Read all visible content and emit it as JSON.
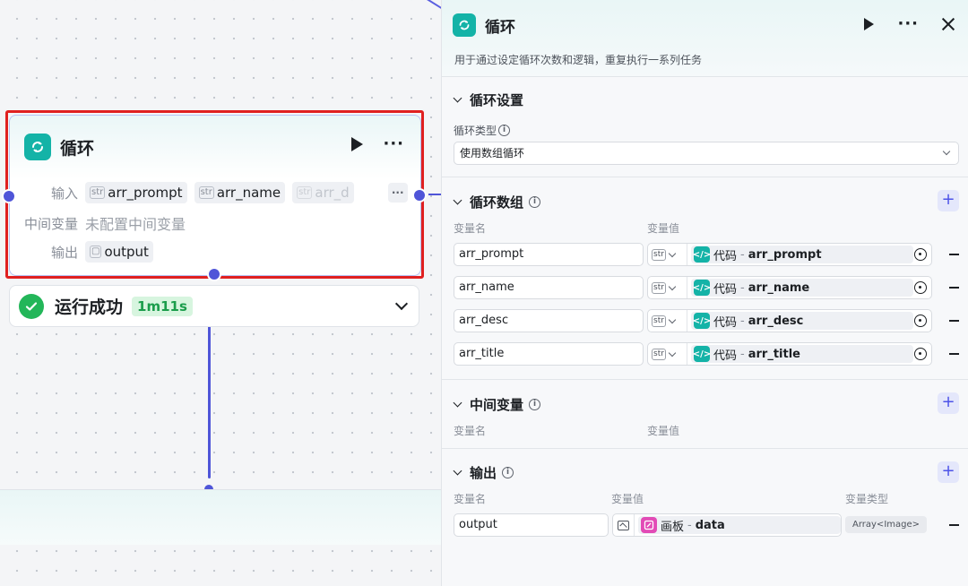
{
  "node": {
    "title": "循环",
    "input_label": "输入",
    "inputs": [
      {
        "type": "str",
        "name": "arr_prompt"
      },
      {
        "type": "str",
        "name": "arr_name"
      },
      {
        "type": "str",
        "name": "arr_d"
      }
    ],
    "more": "···",
    "mid_label": "中间变量",
    "mid_value": "未配置中间变量",
    "output_label": "输出",
    "output_name": "output"
  },
  "status": {
    "text": "运行成功",
    "duration": "1m11s"
  },
  "panel": {
    "title": "循环",
    "description": "用于通过设定循环次数和逻辑，重复执行一系列任务",
    "settings": {
      "title": "循环设置",
      "type_label": "循环类型",
      "type_value": "使用数组循环"
    },
    "array": {
      "title": "循环数组",
      "col_name": "变量名",
      "col_value": "变量值",
      "rows": [
        {
          "name": "arr_prompt",
          "type": "str",
          "source": "代码",
          "sep": "-",
          "var": "arr_prompt"
        },
        {
          "name": "arr_name",
          "type": "str",
          "source": "代码",
          "sep": "-",
          "var": "arr_name"
        },
        {
          "name": "arr_desc",
          "type": "str",
          "source": "代码",
          "sep": "-",
          "var": "arr_desc"
        },
        {
          "name": "arr_title",
          "type": "str",
          "source": "代码",
          "sep": "-",
          "var": "arr_title"
        }
      ]
    },
    "intermediate": {
      "title": "中间变量",
      "col_name": "变量名",
      "col_value": "变量值"
    },
    "output": {
      "title": "输出",
      "col_name": "变量名",
      "col_value": "变量值",
      "col_type": "变量类型",
      "row": {
        "name": "output",
        "source": "画板",
        "sep": "-",
        "var": "data",
        "type": "Array<Image>"
      }
    }
  },
  "colors": {
    "accent": "#4f55d8",
    "loop_icon": "#14b3a7",
    "success": "#23b659",
    "highlight": "#e02020"
  }
}
